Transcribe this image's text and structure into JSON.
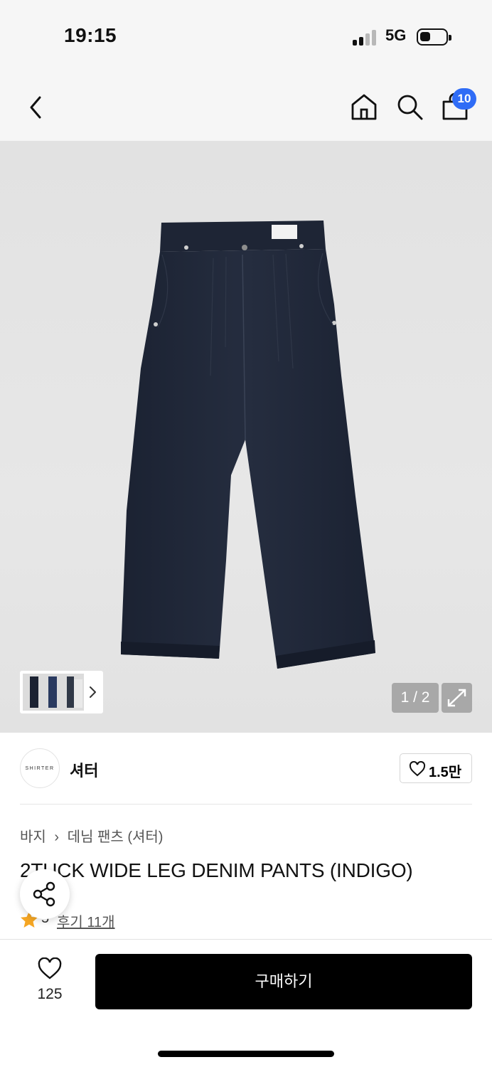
{
  "status_bar": {
    "time": "19:15",
    "network": "5G",
    "battery_icon": "battery-icon",
    "signal_icon": "signal-icon"
  },
  "nav": {
    "back_icon": "chevron-left-icon",
    "home_icon": "home-icon",
    "search_icon": "search-icon",
    "cart_icon": "shopping-bag-icon",
    "cart_badge": "10"
  },
  "gallery": {
    "counter": "1 / 2",
    "expand_icon": "expand-icon",
    "thumbnail_chevron_icon": "chevron-right-icon"
  },
  "brand": {
    "logo_text": "SHIRTER",
    "name": "셔터",
    "like_count": "1.5만"
  },
  "product": {
    "breadcrumb": [
      "바지",
      "데님 팬츠 (셔터)"
    ],
    "title": "2TUCK WIDE LEG DENIM PANTS (INDIGO)",
    "rating": "5",
    "reviews": "후기 11개"
  },
  "bottom_bar": {
    "wish_count": "125",
    "buy_label": "구매하기"
  },
  "colors": {
    "accent_badge": "#2f6cf6",
    "star": "#f5a623",
    "buy_button": "#000000",
    "denim": "#1f2636"
  }
}
